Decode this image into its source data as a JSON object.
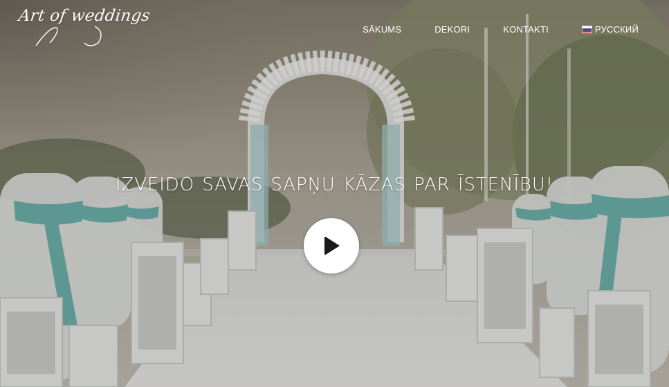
{
  "brand": {
    "logo_text": "Art of weddings"
  },
  "nav": {
    "items": [
      {
        "label": "SĀKUMS"
      },
      {
        "label": "DEKORI"
      },
      {
        "label": "KONTAKTI"
      },
      {
        "label": "РУССКИЙ",
        "icon": "russian-flag-icon"
      }
    ]
  },
  "hero": {
    "headline": "IZVEIDO SAVAS SAPŅU KĀZAS PAR ĪSTENĪBU!",
    "play_icon": "play-icon",
    "background_description_colors": {
      "sky": "#a9a396",
      "trees": "#6f7a55",
      "aisle": "#dfe3e1",
      "ribbon": "#5fb3ad"
    }
  }
}
